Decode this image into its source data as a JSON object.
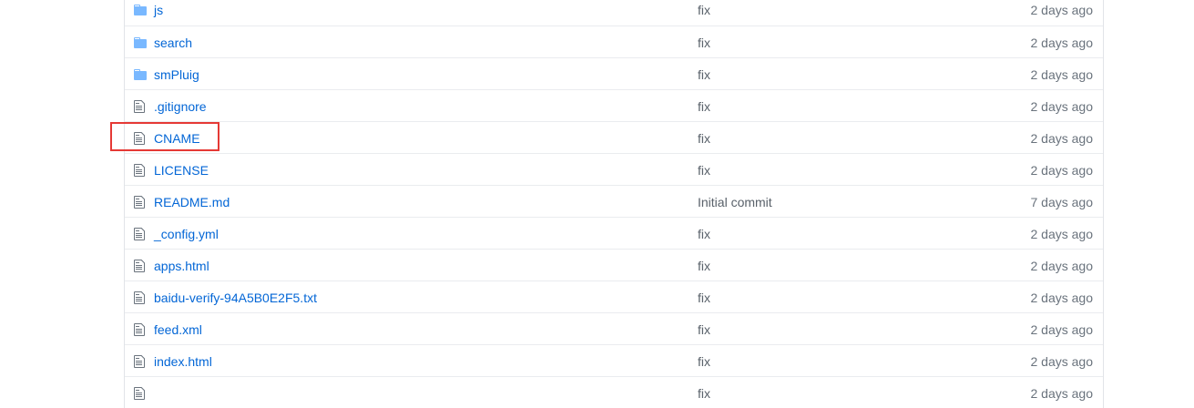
{
  "colors": {
    "link": "#0366d6",
    "folder_icon": "#79b8ff",
    "file_icon": "#6a737d",
    "highlight": "#e53935"
  },
  "highlighted_item": "CNAME",
  "files": [
    {
      "name": "js",
      "type": "folder",
      "icon": "folder-icon",
      "message": "fix",
      "age": "2 days ago"
    },
    {
      "name": "search",
      "type": "folder",
      "icon": "folder-icon",
      "message": "fix",
      "age": "2 days ago"
    },
    {
      "name": "smPluig",
      "type": "folder",
      "icon": "folder-icon",
      "message": "fix",
      "age": "2 days ago"
    },
    {
      "name": ".gitignore",
      "type": "file",
      "icon": "file-icon",
      "message": "fix",
      "age": "2 days ago"
    },
    {
      "name": "CNAME",
      "type": "file",
      "icon": "file-icon",
      "message": "fix",
      "age": "2 days ago"
    },
    {
      "name": "LICENSE",
      "type": "file",
      "icon": "file-icon",
      "message": "fix",
      "age": "2 days ago"
    },
    {
      "name": "README.md",
      "type": "file",
      "icon": "file-icon",
      "message": "Initial commit",
      "age": "7 days ago"
    },
    {
      "name": "_config.yml",
      "type": "file",
      "icon": "file-icon",
      "message": "fix",
      "age": "2 days ago"
    },
    {
      "name": "apps.html",
      "type": "file",
      "icon": "file-icon",
      "message": "fix",
      "age": "2 days ago"
    },
    {
      "name": "baidu-verify-94A5B0E2F5.txt",
      "type": "file",
      "icon": "file-icon",
      "message": "fix",
      "age": "2 days ago"
    },
    {
      "name": "feed.xml",
      "type": "file",
      "icon": "file-icon",
      "message": "fix",
      "age": "2 days ago"
    },
    {
      "name": "index.html",
      "type": "file",
      "icon": "file-icon",
      "message": "fix",
      "age": "2 days ago"
    },
    {
      "name": "",
      "type": "file",
      "icon": "file-icon",
      "message": "fix",
      "age": "2 days ago"
    }
  ]
}
